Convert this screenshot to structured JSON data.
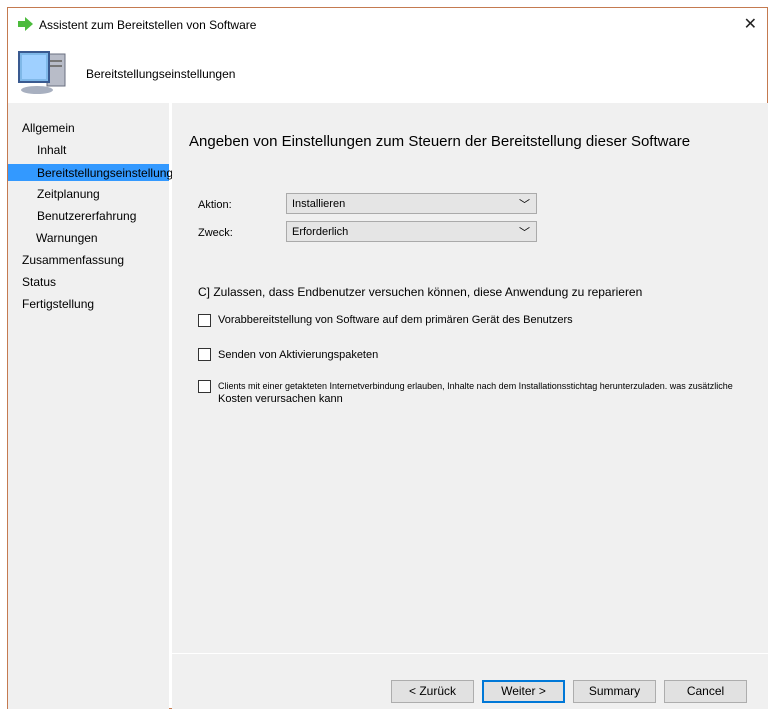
{
  "window": {
    "title": "Assistent zum Bereitstellen von Software",
    "header": "Bereitstellungseinstellungen"
  },
  "sidebar": {
    "items": [
      {
        "label": "Allgemein",
        "level": 0
      },
      {
        "label": "Inhalt",
        "level": 1
      },
      {
        "label": "Bereitstellungseinstellungen",
        "level": 1,
        "selected": true
      },
      {
        "label": "Zeitplanung",
        "level": 1
      },
      {
        "label": "Benutzererfahrung",
        "level": 1
      },
      {
        "label": "Warnungen",
        "level": 1
      },
      {
        "label": "Zusammenfassung",
        "level": 0
      },
      {
        "label": "Status",
        "level": 0
      },
      {
        "label": "Fertigstellung",
        "level": 0
      }
    ]
  },
  "main": {
    "heading": "Angeben von Einstellungen zum Steuern der Bereitstellung dieser Software",
    "action_label": "Aktion:",
    "action_value": "Installieren",
    "purpose_label": "Zweck:",
    "purpose_value": "Erforderlich",
    "repair_option": "C] Zulassen, dass Endbenutzer versuchen können, diese Anwendung zu reparieren",
    "checkboxes": [
      {
        "label": "Vorabbereitstellung von Software auf dem primären Gerät des Benutzers",
        "checked": false
      },
      {
        "label": "Senden von Aktivierungspaketen",
        "checked": false
      },
      {
        "label": "Clients mit einer getakteten Internetverbindung erlauben, Inhalte nach dem Installationsstichtag herunterzuladen. was zusätzliche",
        "label2": "Kosten verursachen kann",
        "checked": false
      }
    ]
  },
  "footer": {
    "back": "< Zurück",
    "next": "Weiter >",
    "summary": "Summary",
    "cancel": "Cancel"
  }
}
